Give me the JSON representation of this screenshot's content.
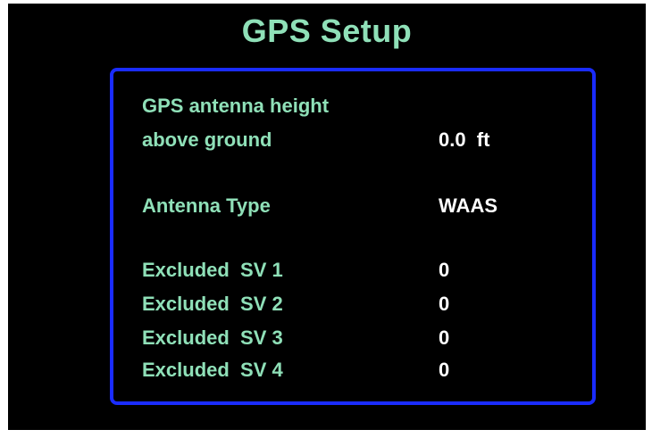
{
  "title": "GPS Setup",
  "antenna_height": {
    "label_line1": "GPS antenna height",
    "label_line2": "above ground",
    "value": "0.0  ft"
  },
  "antenna_type": {
    "label": "Antenna Type",
    "value": "WAAS"
  },
  "excluded_sv": [
    {
      "label": "Excluded  SV 1",
      "value": "0"
    },
    {
      "label": "Excluded  SV 2",
      "value": "0"
    },
    {
      "label": "Excluded  SV 3",
      "value": "0"
    },
    {
      "label": "Excluded  SV 4",
      "value": "0"
    }
  ],
  "colors": {
    "label": "#8fe0b8",
    "value": "#ffffff",
    "border": "#1a2cff",
    "background": "#000000"
  }
}
